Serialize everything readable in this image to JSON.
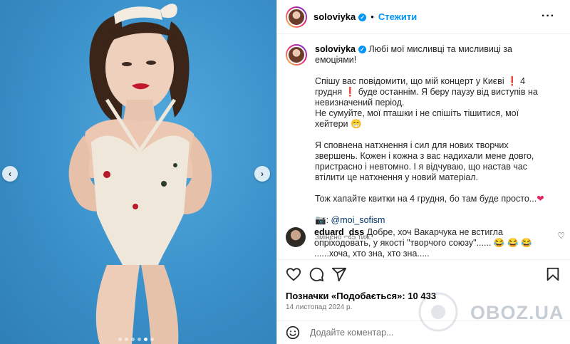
{
  "post": {
    "username": "soloviyka",
    "separator": "•",
    "follow_label": "Стежити",
    "more_icon": "more-horizontal-icon"
  },
  "caption": {
    "username": "soloviyka",
    "line1": "Любі мої мисливці та мисливиці за емоціями!",
    "p1_a": "Спішу вас повідомити, що мій концерт у Києві",
    "p1_b": "4 грудня",
    "p1_c": "буде останнім. Я беру паузу від виступів на невизначений період.",
    "p1_d": "Не сумуйте, мої пташки і не спішіть тішитися, мої хейтери",
    "p2": "Я сповнена натхнення і сил для нових творчих звершень. Кожен і кожна з вас надихали мене довго, пристрасно і невтомно. І я відчуваю, що настав час втілити це натхнення у новий матеріал.",
    "p3": "Тож хапайте квитки на 4 грудня, бо там буде просто...",
    "camera": "📷:",
    "mention": "@moi_sofism",
    "edited": "Змінено · 45 тиж."
  },
  "comment": {
    "username": "eduard_dss",
    "text_a": "Добре, хоч Вакарчука не встигла опріходовать, у якості \"творчого союзу\"......",
    "emojis": "😂 😂 😂",
    "text_b": "......хоча, хто зна, хто зна.....",
    "like_icon": "heart-outline-icon"
  },
  "footer": {
    "likes_label": "Позначки «Подобається»:",
    "likes_count": "10 433",
    "date": "14 листопад 2024 р.",
    "comment_placeholder": "Додайте коментар..."
  },
  "carousel": {
    "dot_count": 6,
    "active_dot": 5
  },
  "watermark": "OBOZ.UA",
  "colors": {
    "accent": "#0095f6",
    "background_blue": "#3a90c9",
    "text": "#262626",
    "muted": "#737373"
  }
}
